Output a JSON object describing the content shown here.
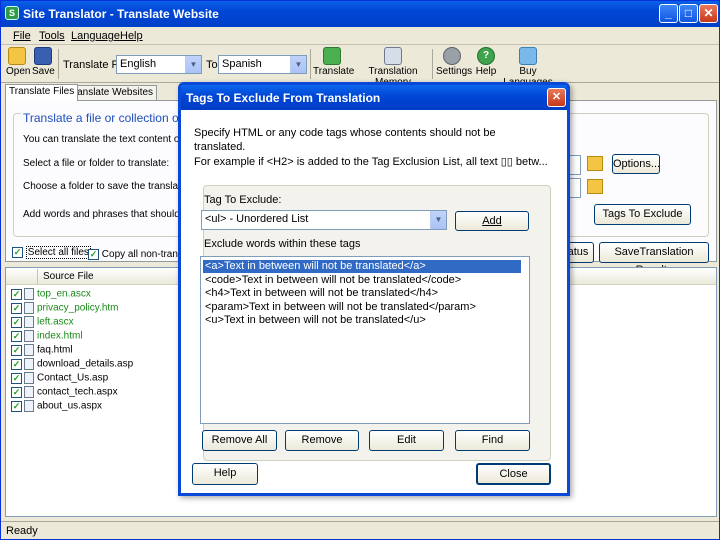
{
  "app": {
    "title": "Site Translator - Translate Website"
  },
  "menu": [
    "File",
    "Tools",
    "Language",
    "Help"
  ],
  "toolbar": {
    "open": "Open",
    "save": "Save",
    "translate_from_label": "Translate From",
    "from_value": "English",
    "to_label": "To",
    "to_value": "Spanish",
    "translate": "Translate",
    "translation_memory": "Translation Memory",
    "settings": "Settings",
    "help": "Help",
    "buy_languages": "Buy Languages"
  },
  "tabs": [
    "Translate Files",
    "Translate Websites"
  ],
  "main": {
    "group_title": "Translate a file or collection of files",
    "intro": "You can translate the text content of HTM, HT",
    "select_label": "Select a file or folder to translate:",
    "choose_label": "Choose a folder to save the translated files in:",
    "words_label": "Add words and phrases that should not be tra",
    "options_btn": "Options...",
    "tags_btn": "Tags To Exclude",
    "select_all": "Select all files",
    "copy_all": "Copy all non-transla",
    "status_btn": "atus",
    "save_results_btn": "SaveTranslation Results"
  },
  "filelist": {
    "header": "Source File",
    "files": [
      "top_en.ascx",
      "privacy_policy.htm",
      "left.ascx",
      "index.html",
      "faq.html",
      "download_details.asp",
      "Contact_Us.asp",
      "contact_tech.aspx",
      "about_us.aspx"
    ]
  },
  "status": "Ready",
  "dialog": {
    "title": "Tags To Exclude From Translation",
    "desc1": "Specify HTML or any code tags whose contents should not be",
    "desc2": "translated.",
    "desc3": "For example if <H2> is added to the Tag Exclusion List, all text ▯▯ betw...",
    "tag_label": "Tag To Exclude:",
    "tag_value": "<ul>  -  Unordered List",
    "add_btn": "Add",
    "exclude_label": "Exclude words within these tags",
    "tags": [
      "<a>Text in between will not be translated</a>",
      "<code>Text in between will not be translated</code>",
      "<h4>Text in between will not be translated</h4>",
      "<param>Text in between will not be translated</param>",
      "<u>Text in between will not be translated</u>"
    ],
    "remove_all_btn": "Remove All",
    "remove_btn": "Remove",
    "edit_btn": "Edit",
    "find_btn": "Find",
    "help_btn": "Help",
    "close_btn": "Close"
  }
}
